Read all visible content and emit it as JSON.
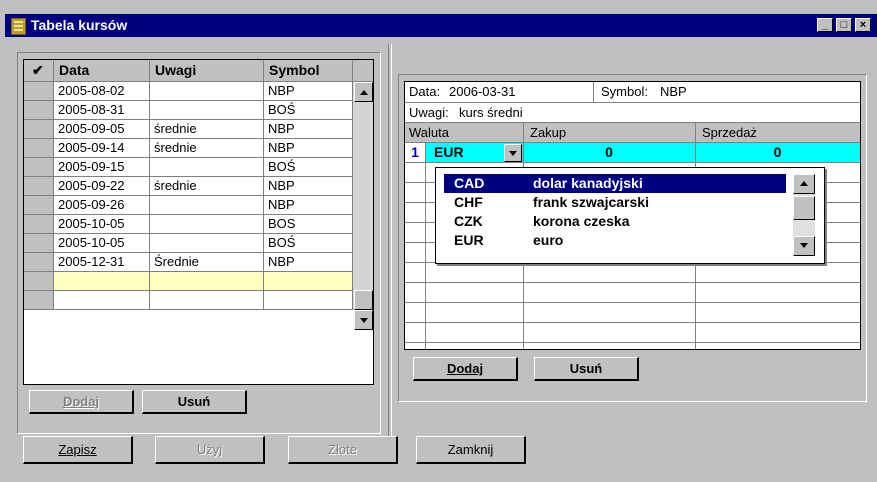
{
  "window": {
    "title": "Tabela kursów",
    "min_label": "_",
    "max_label": "□",
    "close_label": "×"
  },
  "left_grid": {
    "headers": {
      "check": "✔",
      "date": "Data",
      "notes": "Uwagi",
      "symbol": "Symbol"
    },
    "rows": [
      {
        "date": "2005-08-02",
        "notes": "",
        "symbol": "NBP"
      },
      {
        "date": "2005-08-31",
        "notes": "",
        "symbol": "BOŚ"
      },
      {
        "date": "2005-09-05",
        "notes": "średnie",
        "symbol": "NBP"
      },
      {
        "date": "2005-09-14",
        "notes": "średnie",
        "symbol": "NBP"
      },
      {
        "date": "2005-09-15",
        "notes": "",
        "symbol": "BOŚ"
      },
      {
        "date": "2005-09-22",
        "notes": "średnie",
        "symbol": "NBP"
      },
      {
        "date": "2005-09-26",
        "notes": "",
        "symbol": "NBP"
      },
      {
        "date": "2005-10-05",
        "notes": "",
        "symbol": "BOS"
      },
      {
        "date": "2005-10-05",
        "notes": "",
        "symbol": "BOŚ"
      },
      {
        "date": "2005-12-31",
        "notes": "Średnie",
        "symbol": "NBP"
      }
    ],
    "add_label": "Dodaj",
    "delete_label": "Usuń"
  },
  "right_panel": {
    "date_label": "Data:",
    "date_value": "2006-03-31",
    "symbol_label": "Symbol:",
    "symbol_value": "NBP",
    "notes_label": "Uwagi:",
    "notes_value": "kurs średni",
    "headers": {
      "currency": "Waluta",
      "buy": "Zakup",
      "sell": "Sprzedaż"
    },
    "current_row": {
      "index": "1",
      "currency": "EUR",
      "buy": "0",
      "sell": "0"
    },
    "dropdown": [
      {
        "code": "CAD",
        "name": "dolar kanadyjski"
      },
      {
        "code": "CHF",
        "name": "frank szwajcarski"
      },
      {
        "code": "CZK",
        "name": "korona czeska"
      },
      {
        "code": "EUR",
        "name": "euro"
      }
    ],
    "add_label": "Dodaj",
    "delete_label": "Usuń"
  },
  "bottom": {
    "save": "Zapisz",
    "use": "Użyj",
    "zlote": "Złote",
    "close": "Zamknij"
  },
  "colors": {
    "titlebar": "#000080",
    "selected_row": "#00ffff",
    "new_row": "#ffffc0",
    "dropdown_selected": "#000080"
  }
}
